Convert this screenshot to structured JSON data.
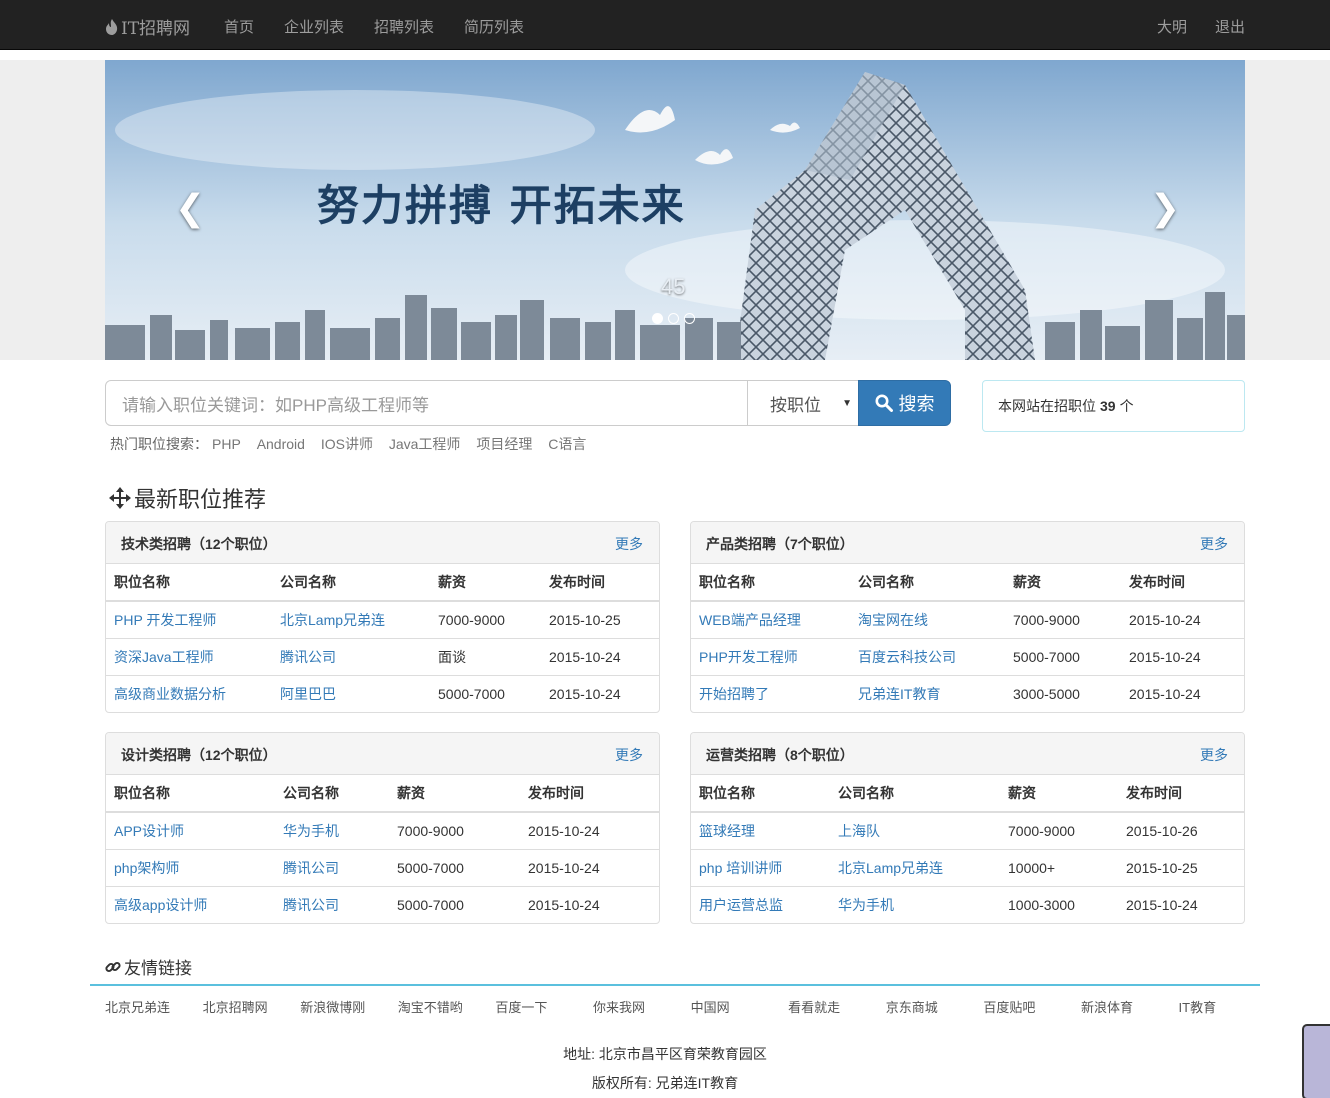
{
  "navbar": {
    "brand": "IT招聘网",
    "links": [
      "首页",
      "企业列表",
      "招聘列表",
      "简历列表"
    ],
    "user": "大明",
    "logout": "退出"
  },
  "carousel": {
    "headline": "努力拼搏  开拓未来",
    "slide_number": "45",
    "prev_icon": "chevron-left-icon",
    "next_icon": "chevron-right-icon",
    "slide_count": 3,
    "active_slide": 1
  },
  "search": {
    "placeholder": "请输入职位关键词：如PHP高级工程师等",
    "select_value": "按职位",
    "button_label": "搜索",
    "hot_label": "热门职位搜索：",
    "hot_tags": [
      "PHP",
      "Android",
      "IOS讲师",
      "Java工程师",
      "项目经理",
      "C语言"
    ]
  },
  "stats": {
    "prefix": "本网站在招职位",
    "count": "39",
    "suffix": "个"
  },
  "section_title": "最新职位推荐",
  "panels": [
    {
      "title": "技术类招聘（12个职位）",
      "more": "更多",
      "headers": [
        "职位名称",
        "公司名称",
        "薪资",
        "发布时间"
      ],
      "rows": [
        [
          "PHP 开发工程师",
          "北京Lamp兄弟连",
          "7000-9000",
          "2015-10-25"
        ],
        [
          "资深Java工程师",
          "腾讯公司",
          "面谈",
          "2015-10-24"
        ],
        [
          "高级商业数据分析",
          "阿里巴巴",
          "5000-7000",
          "2015-10-24"
        ]
      ]
    },
    {
      "title": "产品类招聘（7个职位）",
      "more": "更多",
      "headers": [
        "职位名称",
        "公司名称",
        "薪资",
        "发布时间"
      ],
      "rows": [
        [
          "WEB端产品经理",
          "淘宝网在线",
          "7000-9000",
          "2015-10-24"
        ],
        [
          "PHP开发工程师",
          "百度云科技公司",
          "5000-7000",
          "2015-10-24"
        ],
        [
          "开始招聘了",
          "兄弟连IT教育",
          "3000-5000",
          "2015-10-24"
        ]
      ]
    },
    {
      "title": "设计类招聘（12个职位）",
      "more": "更多",
      "headers": [
        "职位名称",
        "公司名称",
        "薪资",
        "发布时间"
      ],
      "rows": [
        [
          "APP设计师",
          "华为手机",
          "7000-9000",
          "2015-10-24"
        ],
        [
          "php架构师",
          "腾讯公司",
          "5000-7000",
          "2015-10-24"
        ],
        [
          "高级app设计师",
          "腾讯公司",
          "5000-7000",
          "2015-10-24"
        ]
      ]
    },
    {
      "title": "运营类招聘（8个职位）",
      "more": "更多",
      "headers": [
        "职位名称",
        "公司名称",
        "薪资",
        "发布时间"
      ],
      "rows": [
        [
          "篮球经理",
          "上海队",
          "7000-9000",
          "2015-10-26"
        ],
        [
          "php 培训讲师",
          "北京Lamp兄弟连",
          "10000+",
          "2015-10-25"
        ],
        [
          "用户运营总监",
          "华为手机",
          "1000-3000",
          "2015-10-24"
        ]
      ]
    }
  ],
  "friend_links": {
    "title": "友情链接",
    "items": [
      "北京兄弟连",
      "北京招聘网",
      "新浪微博刚",
      "淘宝不错哟",
      "百度一下",
      "你来我网",
      "中国网",
      "看看就走",
      "京东商城",
      "百度贴吧",
      "新浪体育",
      "IT教育"
    ]
  },
  "footer": {
    "address": "地址: 北京市昌平区育荣教育园区",
    "copyright": "版权所有: 兄弟连IT教育"
  },
  "colors": {
    "navbar_bg": "#222222",
    "link": "#337ab7",
    "primary_button": "#337ab7",
    "info_border": "#bce8f1",
    "links_rule": "#5bc0de"
  }
}
